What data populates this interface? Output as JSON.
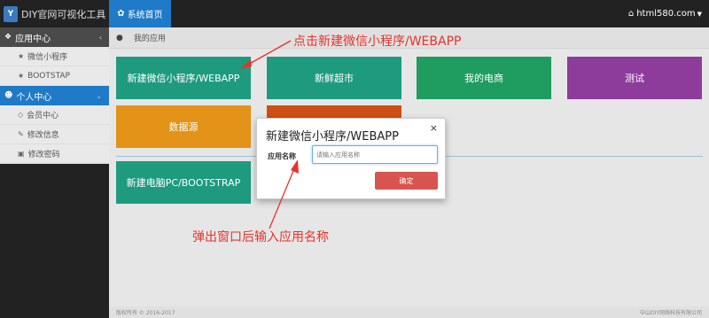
{
  "header": {
    "brand": "DIY官网可视化工具",
    "home_tab": "系统首页",
    "site": "html580.com"
  },
  "sidebar": {
    "groups": [
      {
        "label": "应用中心",
        "items": [
          "微信小程序",
          "BOOTSTAP"
        ]
      },
      {
        "label": "个人中心",
        "items": [
          "会员中心",
          "修改信息",
          "修改密码"
        ]
      }
    ]
  },
  "breadcrumb": {
    "current": "我的应用"
  },
  "tiles": {
    "wechat": "新建微信小程序/WEBAPP",
    "market": "新鲜超市",
    "shop": "我的电商",
    "test": "测试",
    "datasource": "数据源",
    "pc": "新建电脑PC/BOOTSTRAP"
  },
  "modal": {
    "title": "新建微信小程序/WEBAPP",
    "close": "×",
    "label": "应用名称",
    "placeholder": "请输入应用名称",
    "confirm": "确定"
  },
  "footer": {
    "left": "版权所有 © 2016-2017",
    "right": "中山DIY网络科技有限公司"
  },
  "annotations": {
    "top": "点击新建微信小程序/WEBAPP",
    "bottom": "弹出窗口后输入应用名称"
  },
  "colors": {
    "accent": "#1f7ac7",
    "annotation": "#e8322a",
    "tile_green": "#1e9b7f",
    "tile_purple": "#8d3c9c",
    "tile_orange": "#e29318",
    "tile_red": "#cf4e15",
    "danger": "#d9534f"
  }
}
